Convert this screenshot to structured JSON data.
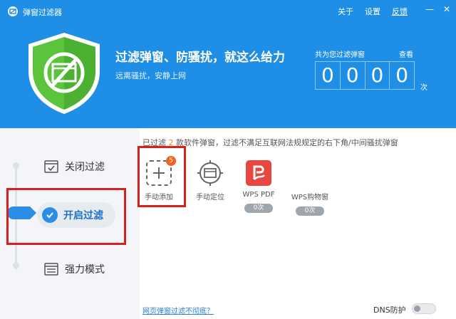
{
  "window": {
    "title": "弹窗过滤器",
    "links": [
      "关于",
      "设置",
      "反馈"
    ],
    "minimize_symbol": "—",
    "close_symbol": "✕"
  },
  "hero": {
    "headline": "过滤弹窗、防骚扰，就这么给力",
    "subline": "远离骚扰，安静上网",
    "count_label": "共为您过滤弹窗",
    "view_link": "查看",
    "digits": [
      "0",
      "0",
      "0",
      "0"
    ],
    "unit": "次"
  },
  "modes": {
    "close_filter": "关闭过滤",
    "open_filter": "开启过滤",
    "strong_mode": "强力模式"
  },
  "info": {
    "prefix": "已过滤 ",
    "count": "2",
    "suffix": " 款软件弹窗，过滤不满足互联网法规规定的右下角/中间骚扰弹窗"
  },
  "apps": [
    {
      "name": "手动添加",
      "badge": "5",
      "icon": "add-dashed-icon"
    },
    {
      "name": "手动定位",
      "icon": "crosshair-window-icon"
    },
    {
      "name": "WPS PDF",
      "count": "0次",
      "icon": "wps-pdf-icon"
    },
    {
      "name": "WPS购物窗",
      "count": "0次",
      "icon": "wps-shopping-icon"
    }
  ],
  "footer": {
    "link": "网页弹窗过滤不彻底？",
    "dns_label": "DNS防护"
  },
  "colors": {
    "header_blue": "#1e8ee6",
    "accent_blue": "#2b8ee6",
    "highlight_red": "#d9211c",
    "badge_orange": "#f0641e",
    "shield_green": "#5cc43c"
  }
}
